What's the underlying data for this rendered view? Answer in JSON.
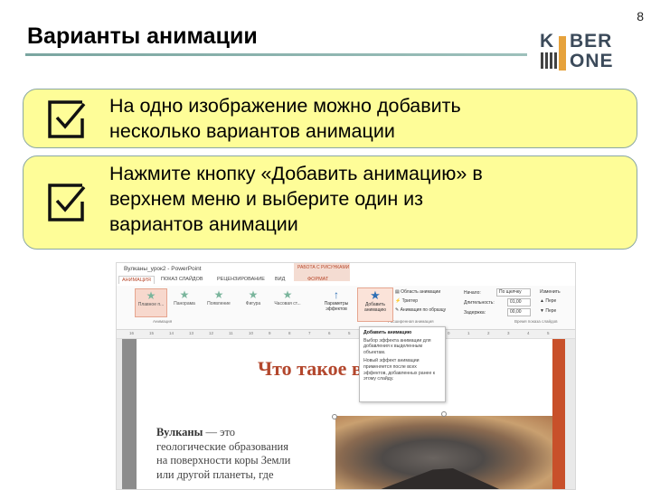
{
  "page": {
    "title": "Варианты анимации",
    "number": "8"
  },
  "logo": {
    "line1_left": "K",
    "line1_right": "BER",
    "line2": "ONE"
  },
  "cards": [
    {
      "text": "На одно изображение можно добавить\nнесколько вариантов анимации",
      "icon": "checkbox-icon"
    },
    {
      "text": "Нажмите кнопку «Добавить анимацию» в\nверхнем меню и выберите один из\nвариантов анимации",
      "icon": "checkbox-icon"
    }
  ],
  "powerpoint": {
    "window_title": "Вулканы_урок2 - PowerPoint",
    "context_tab": "РАБОТА С РИСУНКАМИ",
    "tabs": [
      "АНИМАЦИЯ",
      "ПОКАЗ СЛАЙДОВ",
      "РЕЦЕНЗИРОВАНИЕ",
      "ВИД",
      "ФОРМАТ"
    ],
    "active_tab": "АНИМАЦИЯ",
    "gallery": [
      "Плавное п...",
      "Панорама",
      "Появление",
      "Фигура",
      "Часовая ст..."
    ],
    "effect_params": "Параметры эффектов",
    "group_animation": "Анимация",
    "add_animation": "Добавить анимацию",
    "advanced": [
      "Область анимации",
      "Триггер",
      "Анимация по образцу"
    ],
    "group_advanced": "Расширенная анимация",
    "timing": {
      "start_label": "Начало:",
      "start_value": "По щелчку",
      "duration_label": "Длительность:",
      "duration_value": "01,00",
      "delay_label": "Задержка:",
      "delay_value": "00,00",
      "reorder": "Изменить",
      "earlier": "Пере",
      "later": "Пере"
    },
    "group_timing": "Время показа слайдов",
    "ruler_ticks": [
      "16",
      "15",
      "14",
      "13",
      "12",
      "11",
      "10",
      "9",
      "8",
      "7",
      "6",
      "5",
      "4",
      "3",
      "2",
      "1",
      "0",
      "1",
      "2",
      "3",
      "4",
      "5"
    ],
    "tooltip": {
      "title": "Добавить анимацию",
      "p1": "Выбор эффекта анимации для добавления к выделенным объектам.",
      "p2": "Новый эффект анимации применяется после всех эффектов, добавленных ранее к этому слайду."
    },
    "slide": {
      "title": "Что такое вулкан",
      "body_bold": "Вулканы",
      "body": " — это\nгеологические образования\nна поверхности коры Земли\nили другой планеты, где"
    }
  },
  "colors": {
    "card_fill": "#fefd98",
    "card_border": "#8aa7a3",
    "accent_red": "#b3472d"
  }
}
